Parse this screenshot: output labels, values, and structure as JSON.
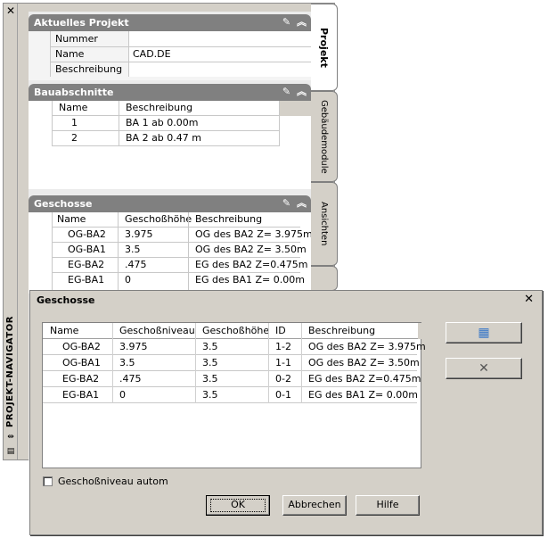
{
  "palette": {
    "title": "PROJEKT-NAVIGATOR",
    "close_glyph": "✕",
    "tabs": [
      {
        "label": "Projekt",
        "active": true
      },
      {
        "label": "Gebäudemodule",
        "active": false
      },
      {
        "label": "Ansichten",
        "active": false
      }
    ],
    "sections": {
      "projekt": {
        "title": "Aktuelles Projekt",
        "rows": [
          {
            "label": "Nummer",
            "value": ""
          },
          {
            "label": "Name",
            "value": "CAD.DE"
          },
          {
            "label": "Beschreibung",
            "value": ""
          }
        ]
      },
      "bauabschnitte": {
        "title": "Bauabschnitte",
        "columns": [
          "Name",
          "Beschreibung"
        ],
        "rows": [
          {
            "name": "1",
            "desc": "BA 1 ab 0.00m"
          },
          {
            "name": "2",
            "desc": "BA 2 ab 0.47 m"
          }
        ]
      },
      "geschosse": {
        "title": "Geschosse",
        "columns": [
          "Name",
          "Geschoßhöhe",
          "Beschreibung"
        ],
        "rows": [
          {
            "name": "OG-BA2",
            "height": "3.975",
            "desc": "OG des BA2 Z= 3.975m"
          },
          {
            "name": "OG-BA1",
            "height": "3.5",
            "desc": "OG des BA2 Z= 3.50m"
          },
          {
            "name": "EG-BA2",
            "height": ".475",
            "desc": "EG des BA2 Z=0.475m"
          },
          {
            "name": "EG-BA1",
            "height": "0",
            "desc": "EG des BA1 Z= 0.00m"
          }
        ]
      }
    }
  },
  "dialog": {
    "title": "Geschosse",
    "close_glyph": "✕",
    "columns": [
      "Name",
      "Geschoßniveau",
      "Geschoßhöhe",
      "ID",
      "Beschreibung"
    ],
    "rows": [
      {
        "name": "OG-BA2",
        "niveau": "3.975",
        "hoehe": "3.5",
        "id": "1-2",
        "desc": "OG des BA2 Z= 3.975m"
      },
      {
        "name": "OG-BA1",
        "niveau": "3.5",
        "hoehe": "3.5",
        "id": "1-1",
        "desc": "OG des BA2 Z= 3.50m"
      },
      {
        "name": "EG-BA2",
        "niveau": ".475",
        "hoehe": "3.5",
        "id": "0-2",
        "desc": "EG des BA2 Z=0.475m"
      },
      {
        "name": "EG-BA1",
        "niveau": "0",
        "hoehe": "3.5",
        "id": "0-1",
        "desc": "EG des BA1 Z= 0.00m"
      }
    ],
    "checkbox_label": "Geschoßniveau autom",
    "checkbox_checked": false,
    "buttons": {
      "ok": "OK",
      "cancel": "Abbrechen",
      "help": "Hilfe"
    },
    "delete_glyph": "✕"
  }
}
